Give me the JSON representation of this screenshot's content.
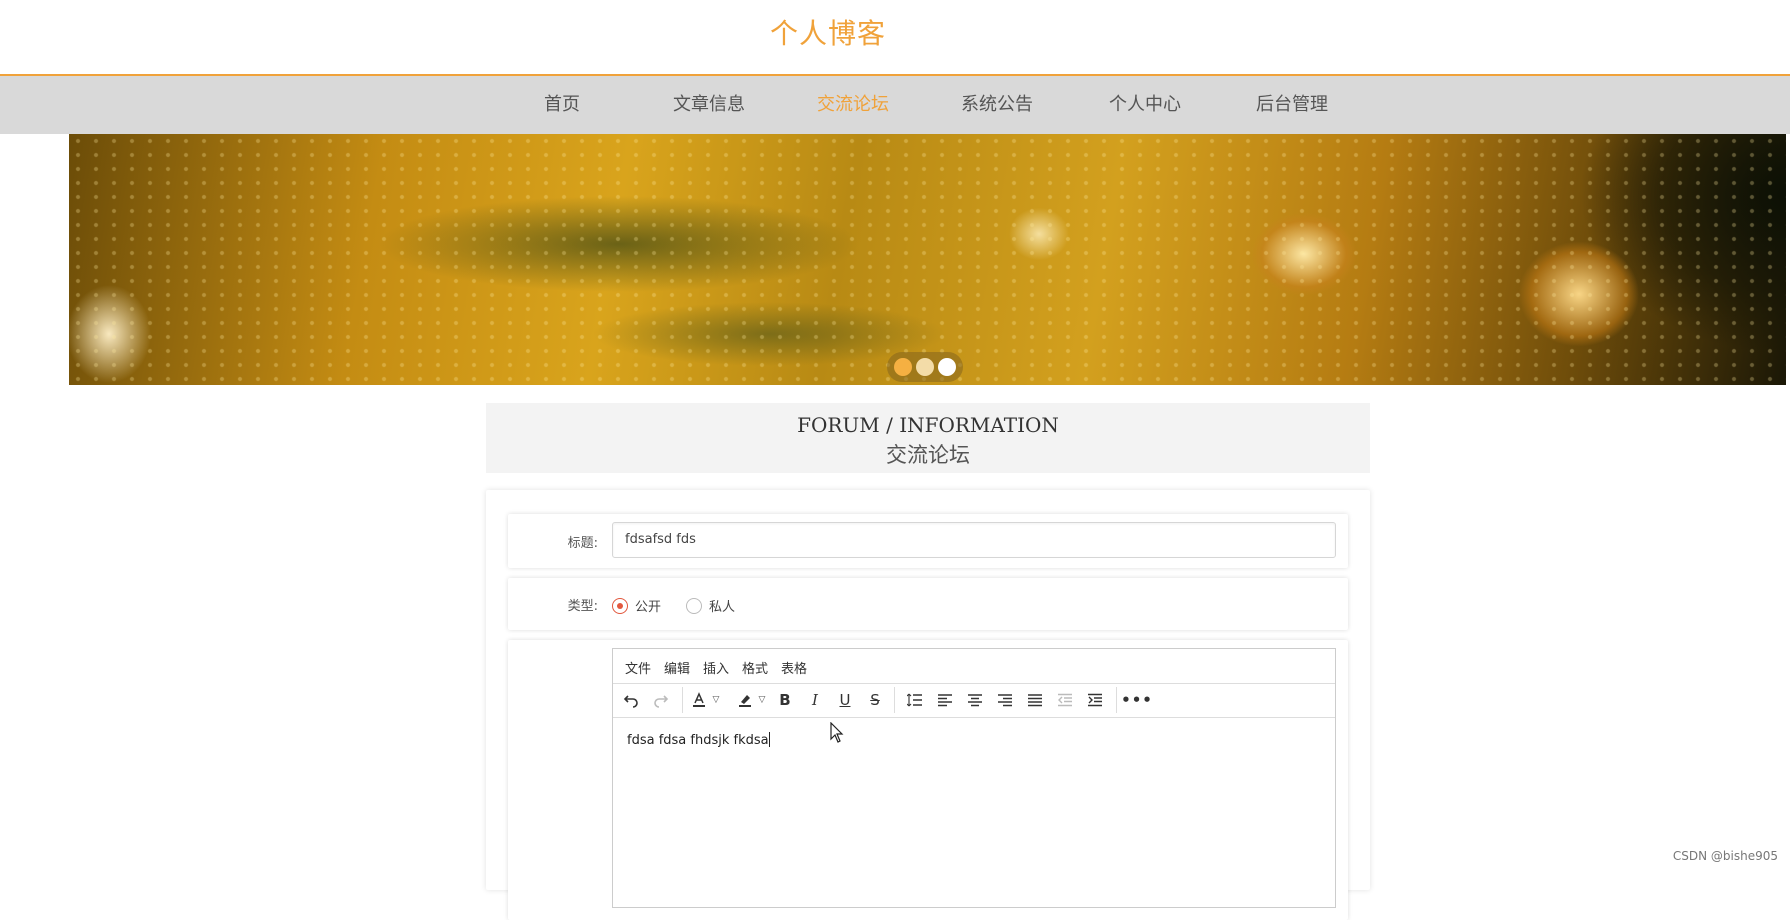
{
  "header": {
    "title": "个人博客"
  },
  "nav": {
    "items": [
      "首页",
      "文章信息",
      "交流论坛",
      "系统公告",
      "个人中心",
      "后台管理"
    ],
    "active": "交流论坛"
  },
  "section": {
    "title_en": "FORUM / INFORMATION",
    "title_cn": "交流论坛"
  },
  "form": {
    "title_label": "标题:",
    "title_value": "fdsafsd fds",
    "type_label": "类型:",
    "type_options": [
      "公开",
      "私人"
    ],
    "type_selected": "公开"
  },
  "editor": {
    "menus": [
      "文件",
      "编辑",
      "插入",
      "格式",
      "表格"
    ],
    "toolbar_icons": [
      "undo-icon",
      "redo-icon",
      "text-color-icon",
      "highlight-color-icon",
      "bold-icon",
      "italic-icon",
      "underline-icon",
      "strikethrough-icon",
      "line-height-icon",
      "align-left-icon",
      "align-center-icon",
      "align-right-icon",
      "align-justify-icon",
      "outdent-icon",
      "indent-icon",
      "more-icon"
    ],
    "content": "fdsa fdsa fhdsjk fkdsa"
  },
  "watermark": "CSDN @bishe905",
  "colors": {
    "accent": "#f0a23a",
    "nav_bg": "#d9d9d9",
    "radio_checked": "#e2583e"
  },
  "banner": {
    "active_slide": 1,
    "slide_count": 3
  }
}
